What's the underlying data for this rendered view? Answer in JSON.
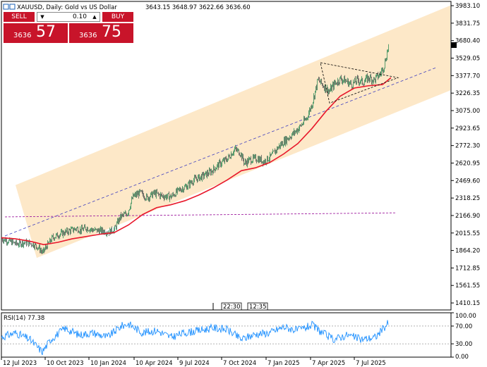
{
  "window": {
    "symbol_title": "XAUUSD, Daily:  Gold vs US Dollar",
    "ohlc": "3643.15  3648.97  3622.66  3636.60"
  },
  "trade_panel": {
    "sell_label": "SELL",
    "buy_label": "BUY",
    "lot_value": "0.10",
    "lot_down_icon": "triangle-down",
    "lot_up_icon": "triangle-up",
    "sell_price_small": "3636",
    "sell_price_big": "57",
    "buy_price_small": "3636",
    "buy_price_big": "75",
    "color": "#c8142a"
  },
  "scroll_markers": [
    "22:30",
    "12:35"
  ],
  "rsi": {
    "label": "RSI(14) 77.38",
    "levels": [
      "100.00",
      "70.00",
      "30.00",
      "0.00"
    ],
    "color": "#1e90ff"
  },
  "chart_data": {
    "type": "candlestick",
    "instrument": "XAUUSD",
    "timeframe": "Daily",
    "y_tick_labels": [
      "3983.10",
      "3831.75",
      "3680.40",
      "3529.05",
      "3377.70",
      "3226.35",
      "3075.00",
      "2923.65",
      "2772.30",
      "2620.95",
      "2469.60",
      "2318.25",
      "2166.90",
      "2015.55",
      "1864.20",
      "1712.85",
      "1561.55",
      "1410.15"
    ],
    "ylim": [
      1349.6,
      4020
    ],
    "x_tick_labels": [
      "12 Jul 2023",
      "10 Oct 2023",
      "10 Jan 2024",
      "10 Apr 2024",
      "9 Jul 2024",
      "7 Oct 2024",
      "7 Jan 2025",
      "7 Apr 2025",
      "7 Jul 2025"
    ],
    "price_path": [
      [
        0,
        1965
      ],
      [
        10,
        1945
      ],
      [
        22,
        1920
      ],
      [
        32,
        1935
      ],
      [
        44,
        1920
      ],
      [
        52,
        1890
      ],
      [
        58,
        1845
      ],
      [
        64,
        1905
      ],
      [
        72,
        1975
      ],
      [
        82,
        2005
      ],
      [
        96,
        2035
      ],
      [
        106,
        2055
      ],
      [
        112,
        2040
      ],
      [
        120,
        2060
      ],
      [
        130,
        2040
      ],
      [
        140,
        2035
      ],
      [
        152,
        2025
      ],
      [
        160,
        2050
      ],
      [
        168,
        2155
      ],
      [
        178,
        2185
      ],
      [
        186,
        2330
      ],
      [
        196,
        2365
      ],
      [
        206,
        2320
      ],
      [
        216,
        2360
      ],
      [
        228,
        2335
      ],
      [
        240,
        2330
      ],
      [
        252,
        2390
      ],
      [
        262,
        2420
      ],
      [
        272,
        2475
      ],
      [
        284,
        2505
      ],
      [
        296,
        2545
      ],
      [
        308,
        2610
      ],
      [
        320,
        2660
      ],
      [
        330,
        2740
      ],
      [
        338,
        2710
      ],
      [
        344,
        2620
      ],
      [
        352,
        2650
      ],
      [
        362,
        2660
      ],
      [
        372,
        2635
      ],
      [
        382,
        2680
      ],
      [
        392,
        2760
      ],
      [
        402,
        2820
      ],
      [
        412,
        2870
      ],
      [
        422,
        2930
      ],
      [
        432,
        3010
      ],
      [
        440,
        3140
      ],
      [
        448,
        3340
      ],
      [
        456,
        3290
      ],
      [
        464,
        3240
      ],
      [
        472,
        3310
      ],
      [
        480,
        3350
      ],
      [
        488,
        3330
      ],
      [
        496,
        3300
      ],
      [
        504,
        3340
      ],
      [
        512,
        3320
      ],
      [
        520,
        3360
      ],
      [
        528,
        3340
      ],
      [
        536,
        3390
      ],
      [
        542,
        3470
      ],
      [
        548,
        3636
      ]
    ],
    "ma_path": [
      [
        0,
        1975
      ],
      [
        20,
        1965
      ],
      [
        40,
        1945
      ],
      [
        60,
        1915
      ],
      [
        80,
        1935
      ],
      [
        100,
        1965
      ],
      [
        120,
        1985
      ],
      [
        140,
        2005
      ],
      [
        160,
        2020
      ],
      [
        180,
        2085
      ],
      [
        200,
        2175
      ],
      [
        220,
        2235
      ],
      [
        240,
        2260
      ],
      [
        260,
        2295
      ],
      [
        280,
        2345
      ],
      [
        300,
        2405
      ],
      [
        320,
        2475
      ],
      [
        340,
        2555
      ],
      [
        360,
        2580
      ],
      [
        380,
        2625
      ],
      [
        400,
        2700
      ],
      [
        420,
        2790
      ],
      [
        440,
        2920
      ],
      [
        460,
        3070
      ],
      [
        480,
        3200
      ],
      [
        500,
        3270
      ],
      [
        520,
        3290
      ],
      [
        540,
        3300
      ],
      [
        552,
        3360
      ]
    ],
    "channel": {
      "upper": [
        [
          20,
          2430
        ],
        [
          636,
          3985
        ]
      ],
      "lower": [
        [
          50,
          1800
        ],
        [
          636,
          3250
        ]
      ],
      "fill": "#fde8c8"
    },
    "channel_midline": {
      "points": [
        [
          5,
          1990
        ],
        [
          615,
          3445
        ]
      ],
      "color": "#3c3cbf",
      "style": "dashed"
    },
    "horizontal_dashed": {
      "points": [
        [
          5,
          2155
        ],
        [
          560,
          2190
        ]
      ],
      "color": "#a020a0"
    },
    "triangle": {
      "points": [
        [
          452,
          3490
        ],
        [
          562,
          3360
        ],
        [
          465,
          3140
        ]
      ],
      "style": "dotted"
    },
    "colors": {
      "bull": "#2e8b57",
      "bear": "#555555",
      "ma": "#e8182b"
    }
  }
}
